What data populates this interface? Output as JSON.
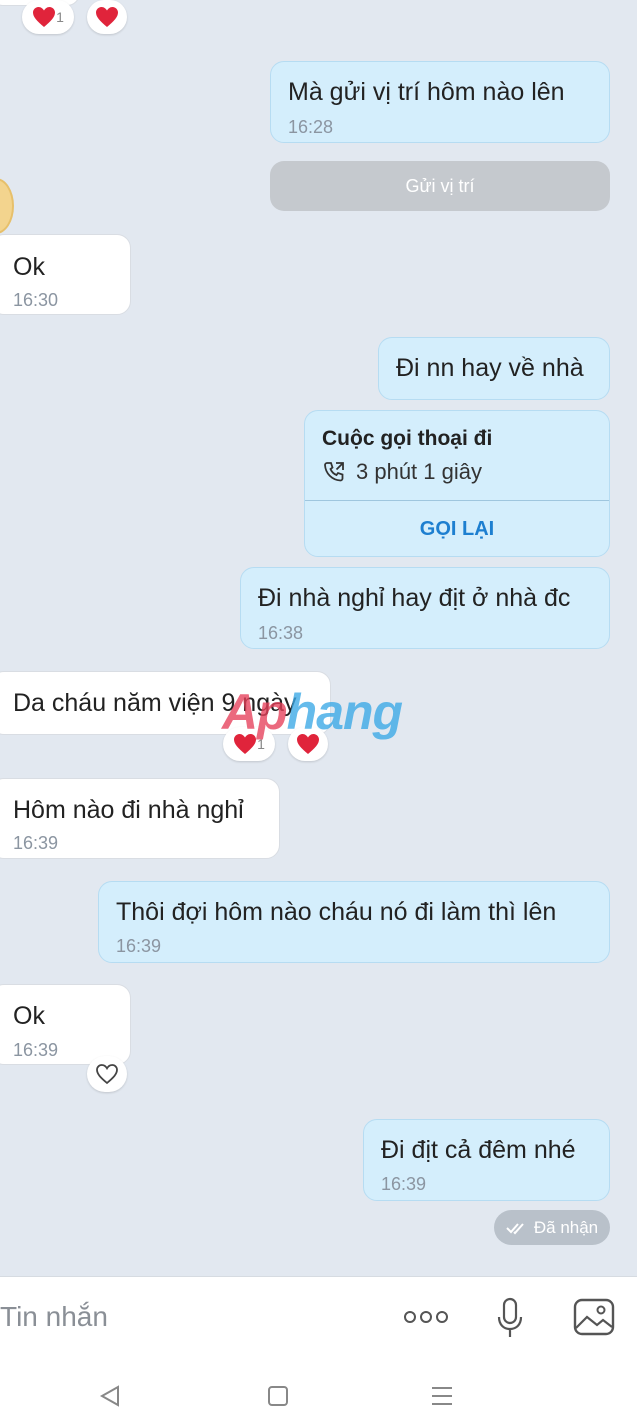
{
  "messages": [
    {
      "id": "m1",
      "text": "Mà gửi vị trí hôm nào lên",
      "time": "16:28"
    },
    {
      "id": "m2",
      "text": "Ok",
      "time": "16:30"
    },
    {
      "id": "m3",
      "text": "Đi nn hay về nhà"
    },
    {
      "id": "m4",
      "text": "Đi nhà nghỉ hay địt ở nhà đc",
      "time": "16:38"
    },
    {
      "id": "m5",
      "text": "Da cháu năm viện 9 ngày"
    },
    {
      "id": "m6",
      "text": "Hôm nào đi nhà nghỉ",
      "time": "16:39"
    },
    {
      "id": "m7",
      "text": "Thôi đợi hôm nào cháu nó đi làm thì lên",
      "time": "16:39"
    },
    {
      "id": "m8",
      "text": "Ok",
      "time": "16:39"
    },
    {
      "id": "m9",
      "text": "Đi địt cả đêm nhé",
      "time": "16:39"
    }
  ],
  "reactions": {
    "count": "1"
  },
  "location_button": "Gửi vị trí",
  "call": {
    "title": "Cuộc gọi thoại đi",
    "duration": "3 phút 1 giây",
    "callback": "GỌI LẠI"
  },
  "status": "Đã nhận",
  "composer": {
    "placeholder": "Tin nhắn"
  },
  "watermark": {
    "part1": "Ap",
    "part2": "hang"
  },
  "icons": [
    "heart-icon",
    "heart-outline-icon",
    "phone-outgoing-icon",
    "double-check-icon",
    "more-icon",
    "microphone-icon",
    "image-icon",
    "nav-back-icon",
    "nav-home-icon",
    "nav-menu-icon"
  ],
  "colors": {
    "background": "#e2e8f0",
    "sent_bubble": "#d4eefc",
    "received_bubble": "#ffffff",
    "accent": "#1d7fd0",
    "heart": "#e0243b"
  }
}
